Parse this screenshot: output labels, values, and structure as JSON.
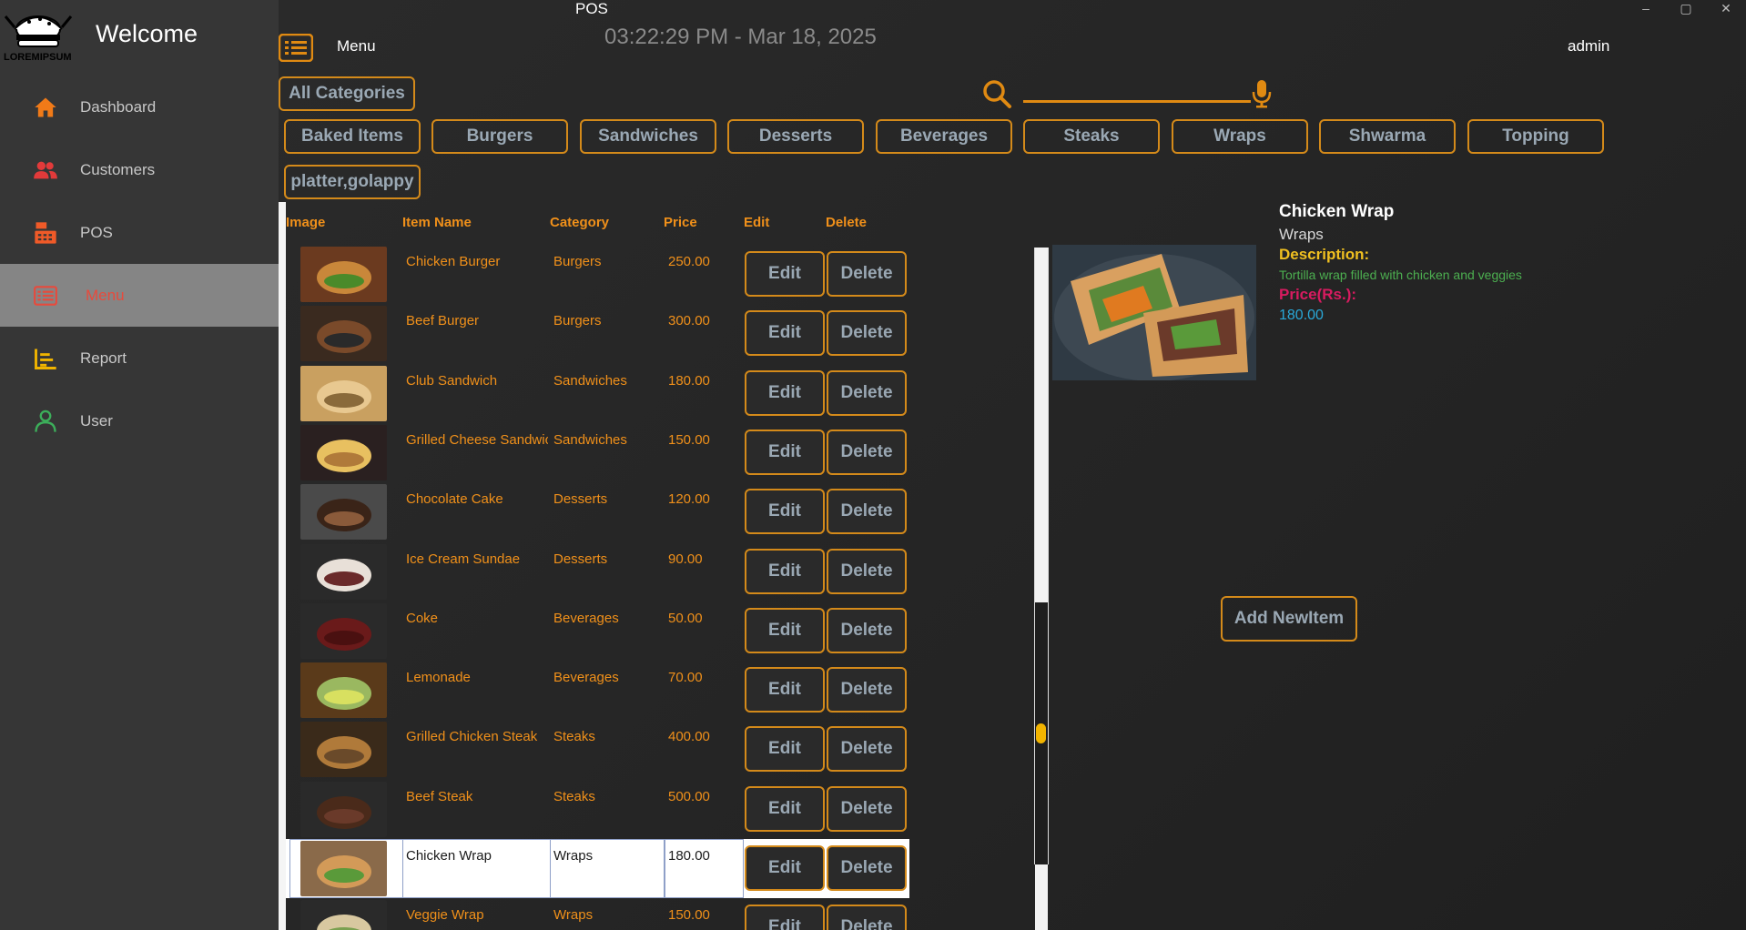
{
  "app": {
    "title": "POS"
  },
  "window": {
    "minimize": "–",
    "maximize": "▢",
    "close": "✕"
  },
  "sidebar": {
    "welcome": "Welcome",
    "logo_text": "LOREMIPSUM",
    "items": [
      {
        "label": "Dashboard",
        "icon": "home-icon",
        "color": "#f07a18"
      },
      {
        "label": "Customers",
        "icon": "users-icon",
        "color": "#e23a3a"
      },
      {
        "label": "POS",
        "icon": "cash-register-icon",
        "color": "#f05a28"
      },
      {
        "label": "Menu",
        "icon": "menu-list-icon",
        "color": "#e84a3c",
        "active": true
      },
      {
        "label": "Report",
        "icon": "chart-icon",
        "color": "#f0b400"
      },
      {
        "label": "User",
        "icon": "user-icon",
        "color": "#3cae5a"
      }
    ]
  },
  "header": {
    "menu_title": "Menu",
    "clock": "03:22:29 PM - Mar 18, 2025",
    "user": "admin"
  },
  "search": {
    "value": "",
    "placeholder": ""
  },
  "categories": [
    "All Categories",
    "Baked Items",
    "Burgers",
    "Sandwiches",
    "Desserts",
    "Beverages",
    "Steaks",
    "Wraps",
    "Shwarma",
    "Topping",
    "platter,golappy"
  ],
  "table": {
    "headers": {
      "image": "Image",
      "name": "Item Name",
      "category": "Category",
      "price": "Price",
      "edit": "Edit",
      "delete": "Delete"
    },
    "edit_label": "Edit",
    "delete_label": "Delete",
    "rows": [
      {
        "name": "Chicken Burger",
        "category": "Burgers",
        "price": "250.00"
      },
      {
        "name": "Beef Burger",
        "category": "Burgers",
        "price": "300.00"
      },
      {
        "name": "Club Sandwich",
        "category": "Sandwiches",
        "price": "180.00"
      },
      {
        "name": "Grilled Cheese Sandwich",
        "category": "Sandwiches",
        "price": "150.00"
      },
      {
        "name": "Chocolate Cake",
        "category": "Desserts",
        "price": "120.00"
      },
      {
        "name": "Ice Cream Sundae",
        "category": "Desserts",
        "price": "90.00"
      },
      {
        "name": "Coke",
        "category": "Beverages",
        "price": "50.00"
      },
      {
        "name": "Lemonade",
        "category": "Beverages",
        "price": "70.00"
      },
      {
        "name": "Grilled Chicken Steak",
        "category": "Steaks",
        "price": "400.00"
      },
      {
        "name": "Beef Steak",
        "category": "Steaks",
        "price": "500.00"
      },
      {
        "name": "Chicken Wrap",
        "category": "Wraps",
        "price": "180.00",
        "selected": true
      },
      {
        "name": "Veggie Wrap",
        "category": "Wraps",
        "price": "150.00"
      }
    ]
  },
  "detail": {
    "name": "Chicken Wrap",
    "category": "Wraps",
    "description_label": "Description:",
    "description": "Tortilla wrap filled with chicken and veggies",
    "price_label": "Price(Rs.):",
    "price": "180.00"
  },
  "actions": {
    "add_new": "Add NewItem"
  },
  "colors": {
    "accent": "#d48a1a",
    "sidebar_bg": "#363636",
    "main_bg": "#2b2b2b"
  }
}
